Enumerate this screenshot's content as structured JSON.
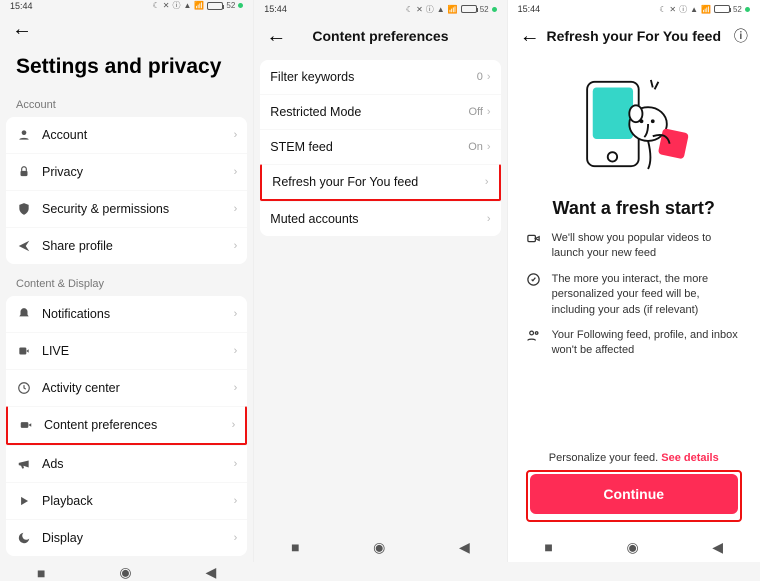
{
  "status": {
    "time": "15:44",
    "battery_pct": "52"
  },
  "screen1": {
    "title": "Settings and privacy",
    "sections": {
      "account": {
        "header": "Account",
        "rows": {
          "account": "Account",
          "privacy": "Privacy",
          "security": "Security & permissions",
          "share": "Share profile"
        }
      },
      "content": {
        "header": "Content & Display",
        "rows": {
          "notifications": "Notifications",
          "live": "LIVE",
          "activity": "Activity center",
          "prefs": "Content preferences",
          "ads": "Ads",
          "playback": "Playback",
          "display": "Display"
        }
      }
    }
  },
  "screen2": {
    "title": "Content preferences",
    "rows": {
      "filter": {
        "label": "Filter keywords",
        "value": "0"
      },
      "restricted": {
        "label": "Restricted Mode",
        "value": "Off"
      },
      "stem": {
        "label": "STEM feed",
        "value": "On"
      },
      "refresh": {
        "label": "Refresh your For You feed"
      },
      "muted": {
        "label": "Muted accounts"
      }
    }
  },
  "screen3": {
    "title": "Refresh your For You feed",
    "heading": "Want a fresh start?",
    "bullets": {
      "b1": "We'll show you popular videos to launch your new feed",
      "b2": "The more you interact, the more personalized your feed will be, including your ads (if relevant)",
      "b3": "Your Following feed, profile, and inbox won't be affected"
    },
    "footnote_lead": "Personalize your feed. ",
    "footnote_link": "See details",
    "cta": "Continue"
  }
}
